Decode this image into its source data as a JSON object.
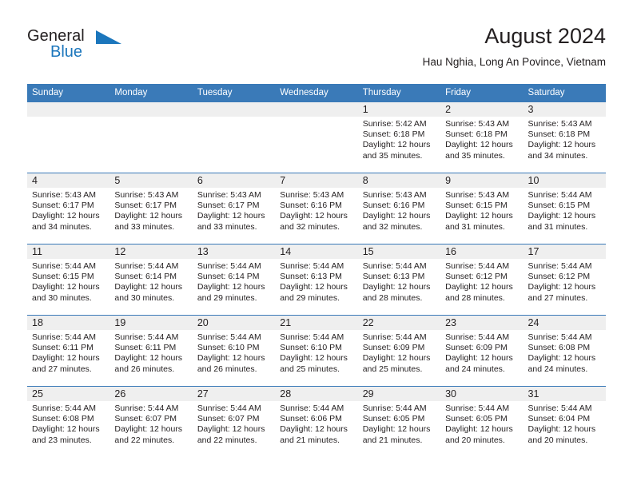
{
  "brand": {
    "name_top": "General",
    "name_bottom": "Blue",
    "accent_color": "#1b76bc"
  },
  "header": {
    "title": "August 2024",
    "subtitle": "Hau Nghia, Long An Povince, Vietnam"
  },
  "theme": {
    "header_band": "#3a7ab8",
    "daynum_band": "#efefef",
    "text": "#231f20"
  },
  "weekday_headers": [
    "Sunday",
    "Monday",
    "Tuesday",
    "Wednesday",
    "Thursday",
    "Friday",
    "Saturday"
  ],
  "labels": {
    "sunrise_prefix": "Sunrise:",
    "sunset_prefix": "Sunset:",
    "daylight_prefix": "Daylight:"
  },
  "weeks": [
    [
      {
        "day": "",
        "empty": true,
        "sunrise": "",
        "sunset": "",
        "daylight_line1": "",
        "daylight_line2": ""
      },
      {
        "day": "",
        "empty": true,
        "sunrise": "",
        "sunset": "",
        "daylight_line1": "",
        "daylight_line2": ""
      },
      {
        "day": "",
        "empty": true,
        "sunrise": "",
        "sunset": "",
        "daylight_line1": "",
        "daylight_line2": ""
      },
      {
        "day": "",
        "empty": true,
        "sunrise": "",
        "sunset": "",
        "daylight_line1": "",
        "daylight_line2": ""
      },
      {
        "day": "1",
        "empty": false,
        "sunrise": "Sunrise: 5:42 AM",
        "sunset": "Sunset: 6:18 PM",
        "daylight_line1": "Daylight: 12 hours",
        "daylight_line2": "and 35 minutes."
      },
      {
        "day": "2",
        "empty": false,
        "sunrise": "Sunrise: 5:43 AM",
        "sunset": "Sunset: 6:18 PM",
        "daylight_line1": "Daylight: 12 hours",
        "daylight_line2": "and 35 minutes."
      },
      {
        "day": "3",
        "empty": false,
        "sunrise": "Sunrise: 5:43 AM",
        "sunset": "Sunset: 6:18 PM",
        "daylight_line1": "Daylight: 12 hours",
        "daylight_line2": "and 34 minutes."
      }
    ],
    [
      {
        "day": "4",
        "empty": false,
        "sunrise": "Sunrise: 5:43 AM",
        "sunset": "Sunset: 6:17 PM",
        "daylight_line1": "Daylight: 12 hours",
        "daylight_line2": "and 34 minutes."
      },
      {
        "day": "5",
        "empty": false,
        "sunrise": "Sunrise: 5:43 AM",
        "sunset": "Sunset: 6:17 PM",
        "daylight_line1": "Daylight: 12 hours",
        "daylight_line2": "and 33 minutes."
      },
      {
        "day": "6",
        "empty": false,
        "sunrise": "Sunrise: 5:43 AM",
        "sunset": "Sunset: 6:17 PM",
        "daylight_line1": "Daylight: 12 hours",
        "daylight_line2": "and 33 minutes."
      },
      {
        "day": "7",
        "empty": false,
        "sunrise": "Sunrise: 5:43 AM",
        "sunset": "Sunset: 6:16 PM",
        "daylight_line1": "Daylight: 12 hours",
        "daylight_line2": "and 32 minutes."
      },
      {
        "day": "8",
        "empty": false,
        "sunrise": "Sunrise: 5:43 AM",
        "sunset": "Sunset: 6:16 PM",
        "daylight_line1": "Daylight: 12 hours",
        "daylight_line2": "and 32 minutes."
      },
      {
        "day": "9",
        "empty": false,
        "sunrise": "Sunrise: 5:43 AM",
        "sunset": "Sunset: 6:15 PM",
        "daylight_line1": "Daylight: 12 hours",
        "daylight_line2": "and 31 minutes."
      },
      {
        "day": "10",
        "empty": false,
        "sunrise": "Sunrise: 5:44 AM",
        "sunset": "Sunset: 6:15 PM",
        "daylight_line1": "Daylight: 12 hours",
        "daylight_line2": "and 31 minutes."
      }
    ],
    [
      {
        "day": "11",
        "empty": false,
        "sunrise": "Sunrise: 5:44 AM",
        "sunset": "Sunset: 6:15 PM",
        "daylight_line1": "Daylight: 12 hours",
        "daylight_line2": "and 30 minutes."
      },
      {
        "day": "12",
        "empty": false,
        "sunrise": "Sunrise: 5:44 AM",
        "sunset": "Sunset: 6:14 PM",
        "daylight_line1": "Daylight: 12 hours",
        "daylight_line2": "and 30 minutes."
      },
      {
        "day": "13",
        "empty": false,
        "sunrise": "Sunrise: 5:44 AM",
        "sunset": "Sunset: 6:14 PM",
        "daylight_line1": "Daylight: 12 hours",
        "daylight_line2": "and 29 minutes."
      },
      {
        "day": "14",
        "empty": false,
        "sunrise": "Sunrise: 5:44 AM",
        "sunset": "Sunset: 6:13 PM",
        "daylight_line1": "Daylight: 12 hours",
        "daylight_line2": "and 29 minutes."
      },
      {
        "day": "15",
        "empty": false,
        "sunrise": "Sunrise: 5:44 AM",
        "sunset": "Sunset: 6:13 PM",
        "daylight_line1": "Daylight: 12 hours",
        "daylight_line2": "and 28 minutes."
      },
      {
        "day": "16",
        "empty": false,
        "sunrise": "Sunrise: 5:44 AM",
        "sunset": "Sunset: 6:12 PM",
        "daylight_line1": "Daylight: 12 hours",
        "daylight_line2": "and 28 minutes."
      },
      {
        "day": "17",
        "empty": false,
        "sunrise": "Sunrise: 5:44 AM",
        "sunset": "Sunset: 6:12 PM",
        "daylight_line1": "Daylight: 12 hours",
        "daylight_line2": "and 27 minutes."
      }
    ],
    [
      {
        "day": "18",
        "empty": false,
        "sunrise": "Sunrise: 5:44 AM",
        "sunset": "Sunset: 6:11 PM",
        "daylight_line1": "Daylight: 12 hours",
        "daylight_line2": "and 27 minutes."
      },
      {
        "day": "19",
        "empty": false,
        "sunrise": "Sunrise: 5:44 AM",
        "sunset": "Sunset: 6:11 PM",
        "daylight_line1": "Daylight: 12 hours",
        "daylight_line2": "and 26 minutes."
      },
      {
        "day": "20",
        "empty": false,
        "sunrise": "Sunrise: 5:44 AM",
        "sunset": "Sunset: 6:10 PM",
        "daylight_line1": "Daylight: 12 hours",
        "daylight_line2": "and 26 minutes."
      },
      {
        "day": "21",
        "empty": false,
        "sunrise": "Sunrise: 5:44 AM",
        "sunset": "Sunset: 6:10 PM",
        "daylight_line1": "Daylight: 12 hours",
        "daylight_line2": "and 25 minutes."
      },
      {
        "day": "22",
        "empty": false,
        "sunrise": "Sunrise: 5:44 AM",
        "sunset": "Sunset: 6:09 PM",
        "daylight_line1": "Daylight: 12 hours",
        "daylight_line2": "and 25 minutes."
      },
      {
        "day": "23",
        "empty": false,
        "sunrise": "Sunrise: 5:44 AM",
        "sunset": "Sunset: 6:09 PM",
        "daylight_line1": "Daylight: 12 hours",
        "daylight_line2": "and 24 minutes."
      },
      {
        "day": "24",
        "empty": false,
        "sunrise": "Sunrise: 5:44 AM",
        "sunset": "Sunset: 6:08 PM",
        "daylight_line1": "Daylight: 12 hours",
        "daylight_line2": "and 24 minutes."
      }
    ],
    [
      {
        "day": "25",
        "empty": false,
        "sunrise": "Sunrise: 5:44 AM",
        "sunset": "Sunset: 6:08 PM",
        "daylight_line1": "Daylight: 12 hours",
        "daylight_line2": "and 23 minutes."
      },
      {
        "day": "26",
        "empty": false,
        "sunrise": "Sunrise: 5:44 AM",
        "sunset": "Sunset: 6:07 PM",
        "daylight_line1": "Daylight: 12 hours",
        "daylight_line2": "and 22 minutes."
      },
      {
        "day": "27",
        "empty": false,
        "sunrise": "Sunrise: 5:44 AM",
        "sunset": "Sunset: 6:07 PM",
        "daylight_line1": "Daylight: 12 hours",
        "daylight_line2": "and 22 minutes."
      },
      {
        "day": "28",
        "empty": false,
        "sunrise": "Sunrise: 5:44 AM",
        "sunset": "Sunset: 6:06 PM",
        "daylight_line1": "Daylight: 12 hours",
        "daylight_line2": "and 21 minutes."
      },
      {
        "day": "29",
        "empty": false,
        "sunrise": "Sunrise: 5:44 AM",
        "sunset": "Sunset: 6:05 PM",
        "daylight_line1": "Daylight: 12 hours",
        "daylight_line2": "and 21 minutes."
      },
      {
        "day": "30",
        "empty": false,
        "sunrise": "Sunrise: 5:44 AM",
        "sunset": "Sunset: 6:05 PM",
        "daylight_line1": "Daylight: 12 hours",
        "daylight_line2": "and 20 minutes."
      },
      {
        "day": "31",
        "empty": false,
        "sunrise": "Sunrise: 5:44 AM",
        "sunset": "Sunset: 6:04 PM",
        "daylight_line1": "Daylight: 12 hours",
        "daylight_line2": "and 20 minutes."
      }
    ]
  ]
}
